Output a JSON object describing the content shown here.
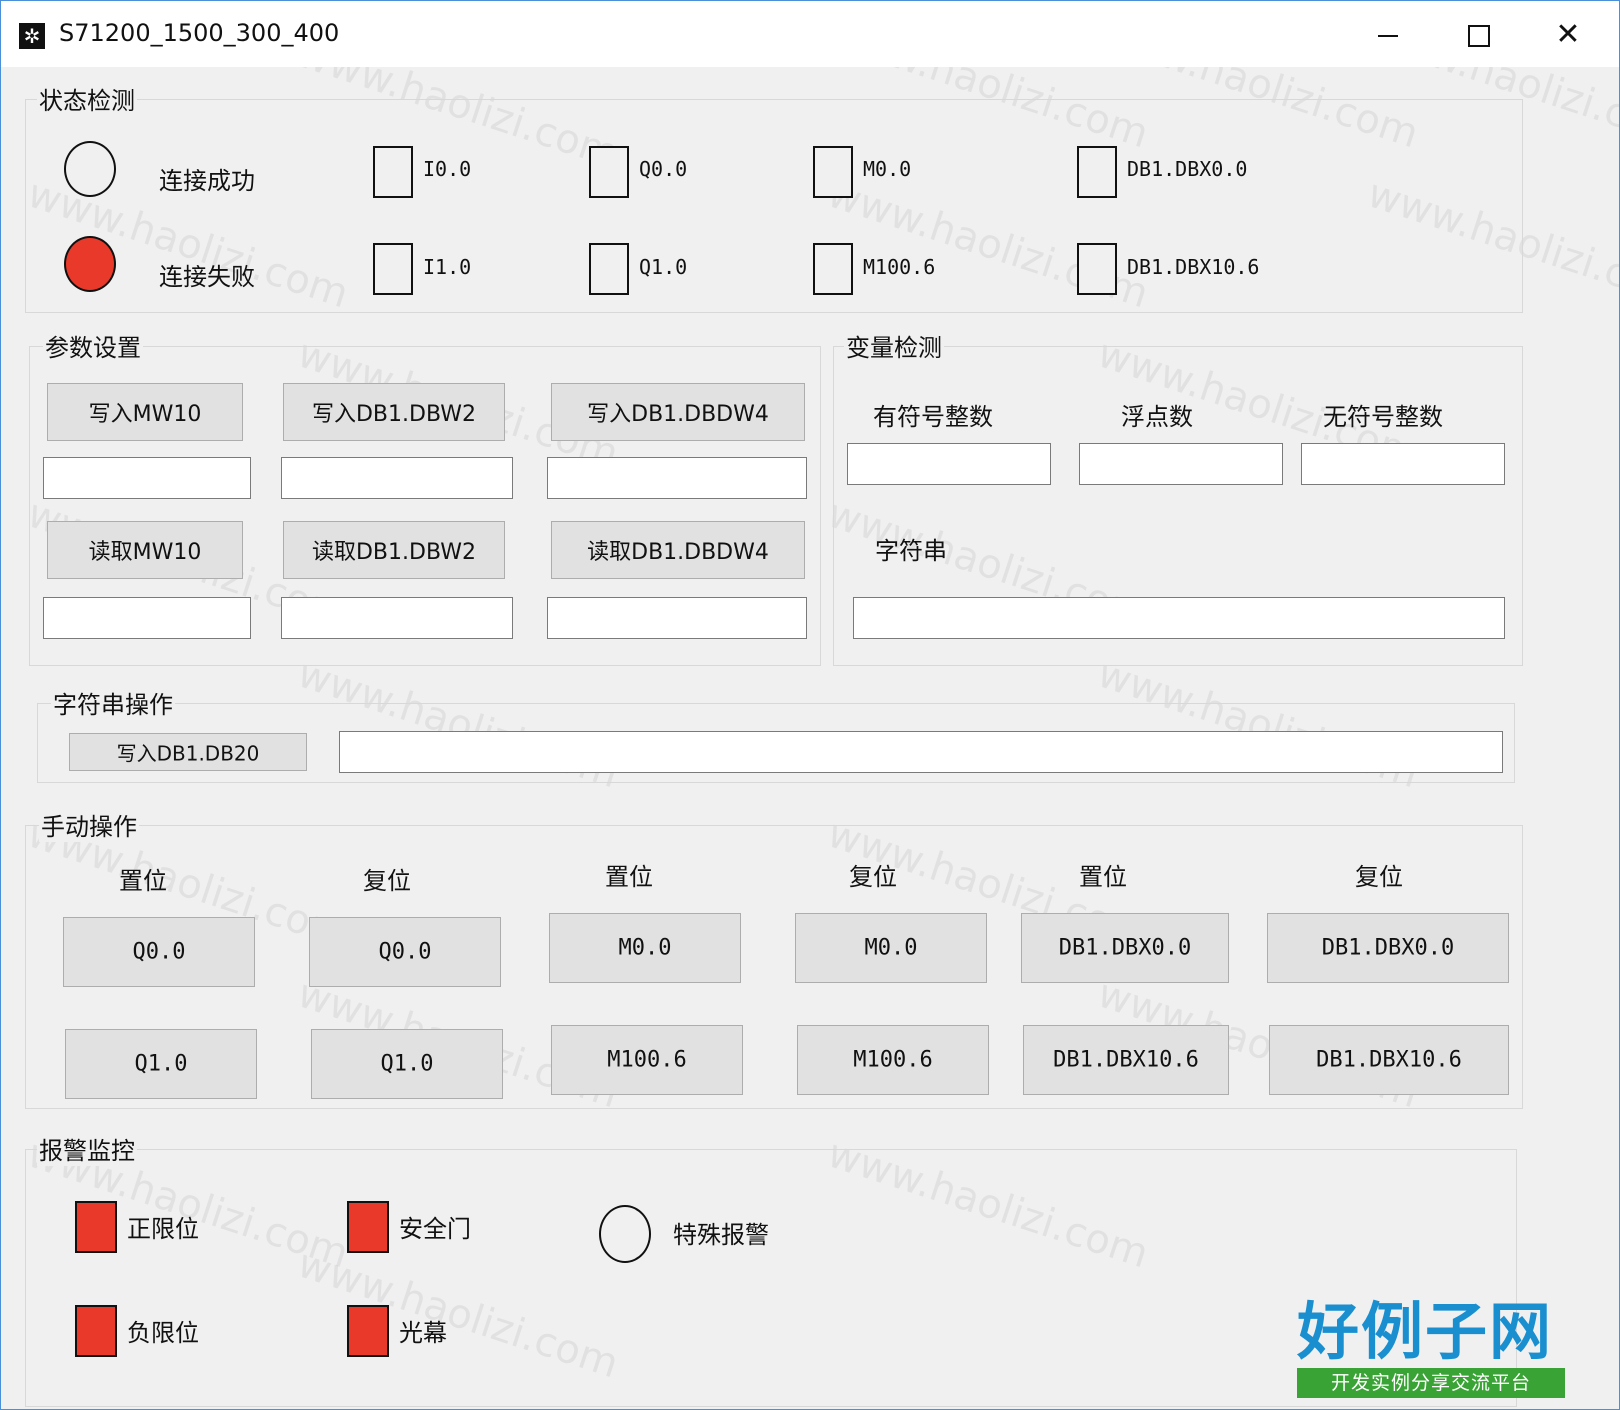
{
  "window": {
    "title": "S71200_1500_300_400",
    "app_icon": "gear-icon",
    "minimize_icon": "minimize-icon",
    "maximize_icon": "maximize-icon",
    "close_icon": "close-icon",
    "close_glyph": "✕"
  },
  "status": {
    "label": "状态检测",
    "connect_ok": "连接成功",
    "connect_fail": "连接失败",
    "connect_fail_color": "#e8392a",
    "inputs": [
      "I0.0",
      "Q0.0",
      "M0.0",
      "DB1.DBX0.0",
      "I1.0",
      "Q1.0",
      "M100.6",
      "DB1.DBX10.6"
    ]
  },
  "params": {
    "label": "参数设置",
    "write_mw10": "写入MW10",
    "write_dbw2": "写入DB1.DBW2",
    "write_dbdw4": "写入DB1.DBDW4",
    "read_mw10": "读取MW10",
    "read_dbw2": "读取DB1.DBW2",
    "read_dbdw4": "读取DB1.DBDW4"
  },
  "variables": {
    "label": "变量检测",
    "signed_int": "有符号整数",
    "float": "浮点数",
    "unsigned_int": "无符号整数",
    "string": "字符串"
  },
  "string_op": {
    "label": "字符串操作",
    "write_db20": "写入DB1.DB20"
  },
  "manual": {
    "label": "手动操作",
    "set": "置位",
    "reset": "复位",
    "q0_0": "Q0.0",
    "q1_0": "Q1.0",
    "m0_0": "M0.0",
    "m100_6": "M100.6",
    "dbx0_0": "DB1.DBX0.0",
    "dbx10_6": "DB1.DBX10.6"
  },
  "alarm": {
    "label": "报警监控",
    "pos_limit": "正限位",
    "neg_limit": "负限位",
    "safety_door": "安全门",
    "light_curtain": "光幕",
    "special_alarm": "特殊报警",
    "alarm_color": "#e8392a"
  },
  "watermark": {
    "logo_main": "好例子网",
    "logo_sub": "开发实例分享交流平台",
    "text": "www.haolizi.com"
  }
}
